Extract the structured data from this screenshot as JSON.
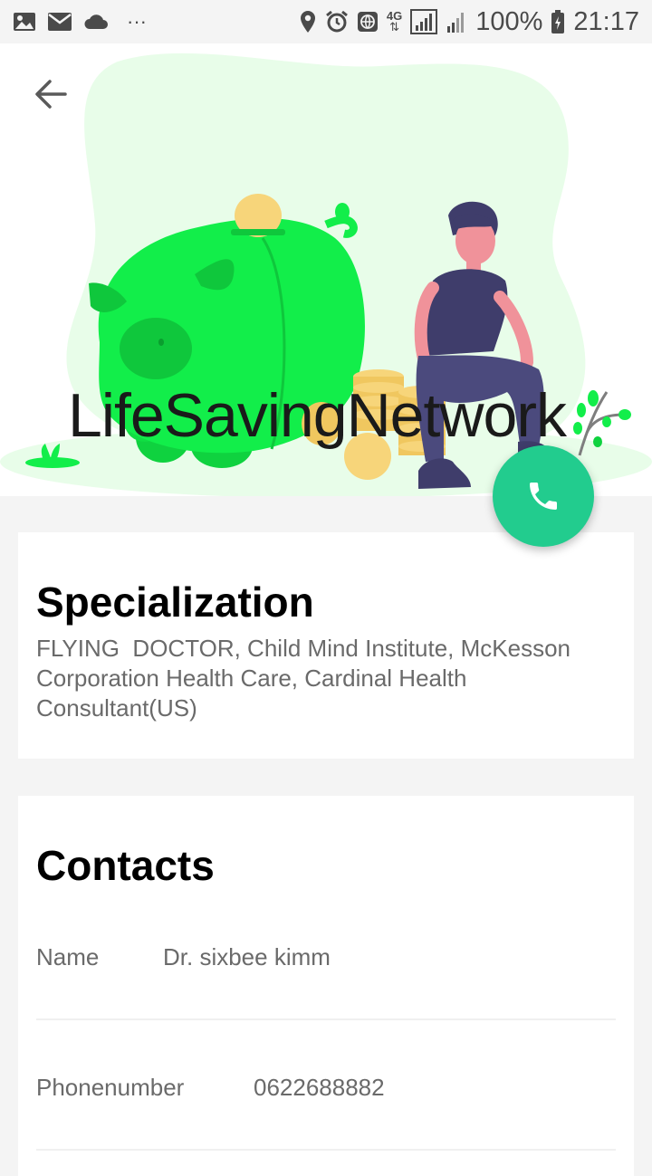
{
  "status_bar": {
    "battery": "100%",
    "time": "21:17",
    "network": "4G",
    "more": "···"
  },
  "header": {
    "app_title": "LifeSavingNetwork"
  },
  "specialization": {
    "heading": "Specialization",
    "text": "FLYING  DOCTOR, Child Mind Institute, McKesson Corporation Health Care, Cardinal Health Consultant(US)"
  },
  "contacts": {
    "heading": "Contacts",
    "rows": [
      {
        "label": "Name",
        "value": "Dr. sixbee kimm"
      },
      {
        "label": "Phonenumber",
        "value": "0622688882"
      }
    ]
  },
  "colors": {
    "accent": "#22cc8e",
    "pig": "#12ee4a",
    "blob": "#e8fde9",
    "coin": "#f7d57a",
    "person_dark": "#3f3d6b",
    "skin": "#f0929a"
  },
  "icons": {
    "back": "arrow-back-icon",
    "call": "phone-icon"
  }
}
